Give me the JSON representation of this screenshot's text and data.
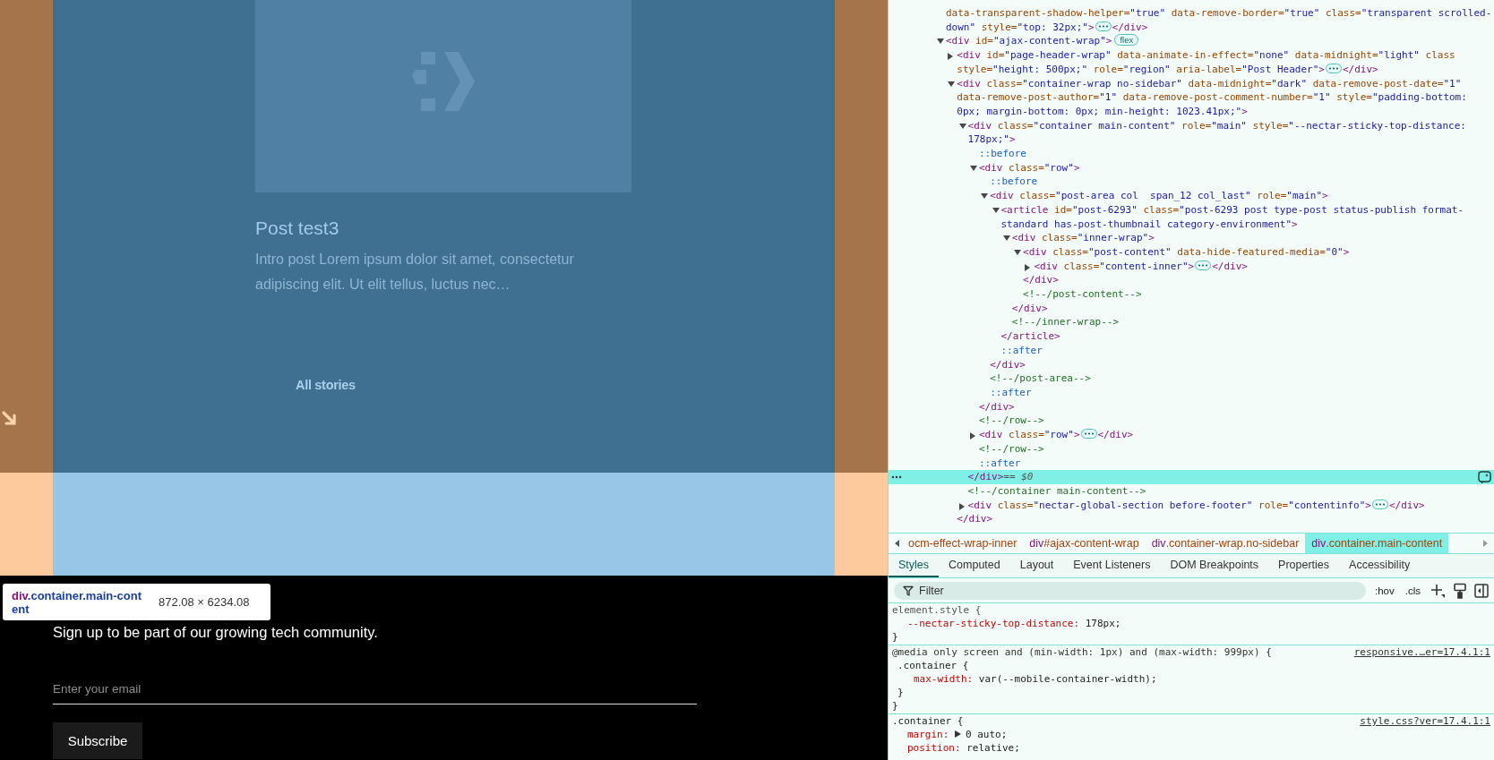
{
  "page": {
    "card": {
      "title": "Post test3",
      "excerpt": "Intro post Lorem ipsum dolor sit amet, consectetur adipiscing elit. Ut elit tellus, luctus nec…"
    },
    "all_stories_link": "All stories",
    "footer": {
      "text": "Sign up to be part of our growing tech community.",
      "email": {
        "placeholder": "Enter your email"
      },
      "button": "Subscribe"
    },
    "inspect_tooltip": {
      "tag": "div",
      "classes": ".container.main-content",
      "size": "872.08 × 6234.08"
    }
  },
  "devtools": {
    "dom": {
      "selected_suffix": "== $0",
      "nodes": [
        {
          "kind": "fragment",
          "expanded": false,
          "open": [
            {
              "kind": "attr",
              "text": "data-transparent-shadow-helper="
            },
            {
              "kind": "value",
              "text": "\"true\""
            },
            {
              "kind": "attr",
              "text": " data-remove-border="
            },
            {
              "kind": "value",
              "text": "\"true\""
            },
            {
              "kind": "attr",
              "text": " class="
            },
            {
              "kind": "value",
              "text": "\"transparent scrolled-down\""
            },
            {
              "kind": "attr",
              "text": " style="
            },
            {
              "kind": "value",
              "text": "\"top: 32px;\""
            },
            {
              "kind": "tag",
              "text": ">"
            }
          ],
          "close": [
            {
              "kind": "tag",
              "text": "</div>"
            }
          ]
        },
        {
          "kind": "element",
          "expanded": true,
          "selected": false,
          "badge": "flex",
          "open": [
            {
              "kind": "tag",
              "text": "<div"
            },
            {
              "kind": "attr",
              "text": " id="
            },
            {
              "kind": "value",
              "text": "\"ajax-content-wrap\""
            },
            {
              "kind": "tag",
              "text": ">"
            }
          ],
          "children": [
            {
              "kind": "element",
              "expanded": false,
              "selected": false,
              "open": [
                {
                  "kind": "tag",
                  "text": "<div"
                },
                {
                  "kind": "attr",
                  "text": " id="
                },
                {
                  "kind": "value",
                  "text": "\"page-header-wrap\""
                },
                {
                  "kind": "attr",
                  "text": " data-animate-in-effect="
                },
                {
                  "kind": "value",
                  "text": "\"none\""
                },
                {
                  "kind": "attr",
                  "text": " data-midnight="
                },
                {
                  "kind": "value",
                  "text": "\"light\""
                },
                {
                  "kind": "attr",
                  "text": " class"
                },
                {
                  "kind": "attr",
                  "text": " style="
                },
                {
                  "kind": "value",
                  "text": "\"height: 500px;\""
                },
                {
                  "kind": "attr",
                  "text": " role="
                },
                {
                  "kind": "value",
                  "text": "\"region\""
                },
                {
                  "kind": "attr",
                  "text": " aria-label="
                },
                {
                  "kind": "value",
                  "text": "\"Post Header\""
                },
                {
                  "kind": "tag",
                  "text": ">"
                }
              ],
              "close": [
                {
                  "kind": "tag",
                  "text": "</div>"
                }
              ]
            },
            {
              "kind": "element",
              "expanded": true,
              "selected": false,
              "open": [
                {
                  "kind": "tag",
                  "text": "<div"
                },
                {
                  "kind": "attr",
                  "text": " class="
                },
                {
                  "kind": "value",
                  "text": "\"container-wrap no-sidebar\""
                },
                {
                  "kind": "attr",
                  "text": " data-midnight="
                },
                {
                  "kind": "value",
                  "text": "\"dark\""
                },
                {
                  "kind": "attr",
                  "text": " data-remove-post-date="
                },
                {
                  "kind": "value",
                  "text": "\"1\""
                },
                {
                  "kind": "attr",
                  "text": " data-remove-post-author="
                },
                {
                  "kind": "value",
                  "text": "\"1\""
                },
                {
                  "kind": "attr",
                  "text": " data-remove-post-comment-number="
                },
                {
                  "kind": "value",
                  "text": "\"1\""
                },
                {
                  "kind": "attr",
                  "text": " style="
                },
                {
                  "kind": "value",
                  "text": "\"padding-bottom: 0px; margin-bottom: 0px; min-height: 1023.41px;\""
                },
                {
                  "kind": "tag",
                  "text": ">"
                }
              ],
              "children": [
                {
                  "kind": "element",
                  "expanded": true,
                  "selected": true,
                  "open": [
                    {
                      "kind": "tag",
                      "text": "<div"
                    },
                    {
                      "kind": "attr",
                      "text": " class="
                    },
                    {
                      "kind": "value",
                      "text": "\"container main-content\""
                    },
                    {
                      "kind": "attr",
                      "text": " role="
                    },
                    {
                      "kind": "value",
                      "text": "\"main\""
                    },
                    {
                      "kind": "attr",
                      "text": " style="
                    },
                    {
                      "kind": "value",
                      "text": "\"--nectar-sticky-top-distance: 178px;\""
                    },
                    {
                      "kind": "tag",
                      "text": ">"
                    }
                  ],
                  "children": [
                    {
                      "kind": "pseudo",
                      "text": "::before"
                    },
                    {
                      "kind": "element",
                      "expanded": true,
                      "selected": false,
                      "open": [
                        {
                          "kind": "tag",
                          "text": "<div"
                        },
                        {
                          "kind": "attr",
                          "text": " class="
                        },
                        {
                          "kind": "value",
                          "text": "\"row\""
                        },
                        {
                          "kind": "tag",
                          "text": ">"
                        }
                      ],
                      "children": [
                        {
                          "kind": "pseudo",
                          "text": "::before"
                        },
                        {
                          "kind": "element",
                          "expanded": true,
                          "selected": false,
                          "open": [
                            {
                              "kind": "tag",
                              "text": "<div"
                            },
                            {
                              "kind": "attr",
                              "text": " class="
                            },
                            {
                              "kind": "value",
                              "text": "\"post-area col  span_12 col_last\""
                            },
                            {
                              "kind": "attr",
                              "text": " role="
                            },
                            {
                              "kind": "value",
                              "text": "\"main\""
                            },
                            {
                              "kind": "tag",
                              "text": ">"
                            }
                          ],
                          "children": [
                            {
                              "kind": "element",
                              "expanded": true,
                              "selected": false,
                              "open": [
                                {
                                  "kind": "tag",
                                  "text": "<article"
                                },
                                {
                                  "kind": "attr",
                                  "text": " id="
                                },
                                {
                                  "kind": "value",
                                  "text": "\"post-6293\""
                                },
                                {
                                  "kind": "attr",
                                  "text": " class="
                                },
                                {
                                  "kind": "value",
                                  "text": "\"post-6293 post type-post status-publish format-standard has-post-thumbnail category-environment\""
                                },
                                {
                                  "kind": "tag",
                                  "text": ">"
                                }
                              ],
                              "children": [
                                {
                                  "kind": "element",
                                  "expanded": true,
                                  "selected": false,
                                  "open": [
                                    {
                                      "kind": "tag",
                                      "text": "<div"
                                    },
                                    {
                                      "kind": "attr",
                                      "text": " class="
                                    },
                                    {
                                      "kind": "value",
                                      "text": "\"inner-wrap\""
                                    },
                                    {
                                      "kind": "tag",
                                      "text": ">"
                                    }
                                  ],
                                  "children": [
                                    {
                                      "kind": "element",
                                      "expanded": true,
                                      "selected": false,
                                      "open": [
                                        {
                                          "kind": "tag",
                                          "text": "<div"
                                        },
                                        {
                                          "kind": "attr",
                                          "text": " class="
                                        },
                                        {
                                          "kind": "value",
                                          "text": "\"post-content\""
                                        },
                                        {
                                          "kind": "attr",
                                          "text": " data-hide-featured-media="
                                        },
                                        {
                                          "kind": "value",
                                          "text": "\"0\""
                                        },
                                        {
                                          "kind": "tag",
                                          "text": ">"
                                        }
                                      ],
                                      "children": [
                                        {
                                          "kind": "element",
                                          "expanded": false,
                                          "selected": false,
                                          "open": [
                                            {
                                              "kind": "tag",
                                              "text": "<div"
                                            },
                                            {
                                              "kind": "attr",
                                              "text": " class="
                                            },
                                            {
                                              "kind": "value",
                                              "text": "\"content-inner\""
                                            },
                                            {
                                              "kind": "tag",
                                              "text": ">"
                                            }
                                          ],
                                          "close": [
                                            {
                                              "kind": "tag",
                                              "text": "</div>"
                                            }
                                          ]
                                        }
                                      ],
                                      "close": [
                                        {
                                          "kind": "tag",
                                          "text": "</div>"
                                        }
                                      ]
                                    },
                                    {
                                      "kind": "comment",
                                      "text": "<!--/post-content-->"
                                    }
                                  ],
                                  "close": [
                                    {
                                      "kind": "tag",
                                      "text": "</div>"
                                    }
                                  ]
                                },
                                {
                                  "kind": "comment",
                                  "text": "<!--/inner-wrap-->"
                                }
                              ],
                              "close": [
                                {
                                  "kind": "tag",
                                  "text": "</article>"
                                }
                              ]
                            },
                            {
                              "kind": "pseudo",
                              "text": "::after"
                            }
                          ],
                          "close": [
                            {
                              "kind": "tag",
                              "text": "</div>"
                            }
                          ]
                        },
                        {
                          "kind": "comment",
                          "text": "<!--/post-area-->"
                        },
                        {
                          "kind": "pseudo",
                          "text": "::after"
                        }
                      ],
                      "close": [
                        {
                          "kind": "tag",
                          "text": "</div>"
                        }
                      ]
                    },
                    {
                      "kind": "comment",
                      "text": "<!--/row-->"
                    },
                    {
                      "kind": "element",
                      "expanded": false,
                      "selected": false,
                      "open": [
                        {
                          "kind": "tag",
                          "text": "<div"
                        },
                        {
                          "kind": "attr",
                          "text": " class="
                        },
                        {
                          "kind": "value",
                          "text": "\"row\""
                        },
                        {
                          "kind": "tag",
                          "text": ">"
                        }
                      ],
                      "close": [
                        {
                          "kind": "tag",
                          "text": "</div>"
                        }
                      ]
                    },
                    {
                      "kind": "comment",
                      "text": "<!--/row-->"
                    },
                    {
                      "kind": "pseudo",
                      "text": "::after"
                    }
                  ],
                  "close": [
                    {
                      "kind": "tag",
                      "text": "</div>"
                    }
                  ]
                },
                {
                  "kind": "comment",
                  "text": "<!--/container main-content-->"
                },
                {
                  "kind": "element",
                  "expanded": false,
                  "selected": false,
                  "open": [
                    {
                      "kind": "tag",
                      "text": "<div"
                    },
                    {
                      "kind": "attr",
                      "text": " class="
                    },
                    {
                      "kind": "value",
                      "text": "\"nectar-global-section before-footer\""
                    },
                    {
                      "kind": "attr",
                      "text": " role="
                    },
                    {
                      "kind": "value",
                      "text": "\"contentinfo\""
                    },
                    {
                      "kind": "tag",
                      "text": ">"
                    }
                  ],
                  "close": [
                    {
                      "kind": "tag",
                      "text": "</div>"
                    }
                  ]
                }
              ],
              "close": [
                {
                  "kind": "tag",
                  "text": "</div>"
                }
              ]
            }
          ]
        }
      ]
    },
    "breadcrumbs": [
      {
        "rest": "ocm-effect-wrap-inner",
        "selected": false
      },
      {
        "tag": "div",
        "rest": "#ajax-content-wrap",
        "selected": false
      },
      {
        "tag": "div",
        "rest": ".container-wrap.no-sidebar",
        "selected": false
      },
      {
        "tag": "div",
        "rest": ".container.main-content",
        "selected": true
      }
    ],
    "tabs": [
      {
        "label": "Styles",
        "selected": true
      },
      {
        "label": "Computed",
        "selected": false
      },
      {
        "label": "Layout",
        "selected": false
      },
      {
        "label": "Event Listeners",
        "selected": false
      },
      {
        "label": "DOM Breakpoints",
        "selected": false
      },
      {
        "label": "Properties",
        "selected": false
      },
      {
        "label": "Accessibility",
        "selected": false
      }
    ],
    "filter": {
      "placeholder": "Filter"
    },
    "toolbar": [
      ":hov",
      ".cls"
    ],
    "styles": [
      {
        "kind": "rule",
        "selector": "element.style {",
        "declarations": [
          {
            "name": "--nectar-sticky-top-distance:",
            "value": "178px;",
            "expandable": false
          }
        ],
        "end": "}"
      },
      {
        "kind": "media",
        "query": "@media only screen and (min-width: 1px) and (max-width: 999px) {",
        "source": "responsive.…er=17.4.1:1",
        "rules": [
          {
            "selector": ".container {",
            "declarations": [
              {
                "name": "max-width:",
                "value": "var(--mobile-container-width);",
                "expandable": false
              }
            ],
            "end": "}"
          }
        ],
        "end": "}"
      },
      {
        "kind": "rule",
        "selector": ".container {",
        "source": "style.css?ver=17.4.1:1",
        "declarations": [
          {
            "name": "margin:",
            "value": "0 auto;",
            "expandable": true
          },
          {
            "name": "position:",
            "value": "relative;",
            "expandable": false
          }
        ]
      }
    ]
  }
}
